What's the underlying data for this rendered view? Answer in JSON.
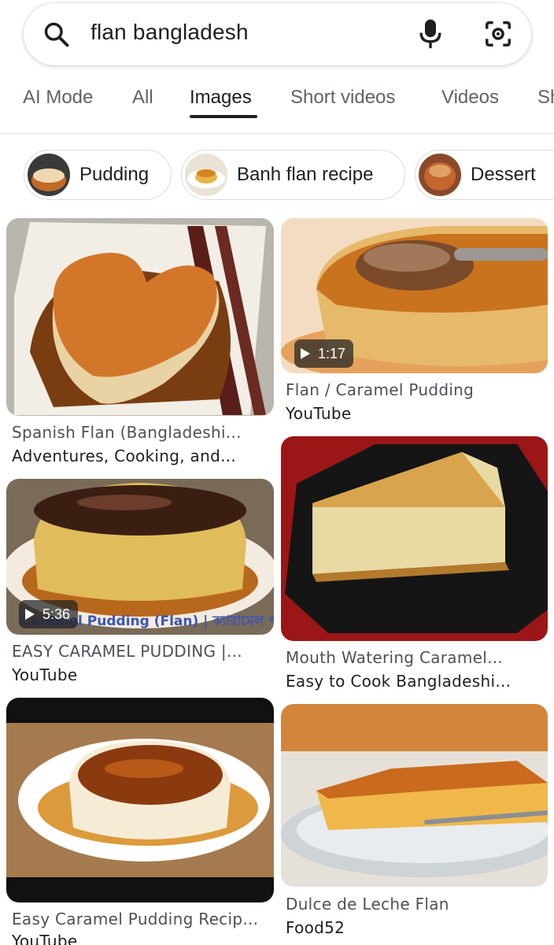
{
  "search": {
    "query": "flan bangladesh"
  },
  "tabs": [
    {
      "label": "AI Mode"
    },
    {
      "label": "All"
    },
    {
      "label": "Images",
      "active": true
    },
    {
      "label": "Short videos"
    },
    {
      "label": "Videos"
    },
    {
      "label": "Sh"
    }
  ],
  "chips": [
    {
      "label": "Pudding"
    },
    {
      "label": "Banh flan recipe"
    },
    {
      "label": "Dessert"
    }
  ],
  "results": [
    {
      "title": "Spanish Flan (Bangladeshi...",
      "source": "Adventures, Cooking, and..."
    },
    {
      "title": "Flan / Caramel Pudding",
      "source": "YouTube",
      "duration": "1:17"
    },
    {
      "title": "EASY CARAMEL PUDDING |...",
      "source": "YouTube",
      "duration": "5:36",
      "overlay": "Caramel Pudding (Flan) | ক্যারামেল পুডিং"
    },
    {
      "title": "Mouth Watering Caramel...",
      "source": "Easy to Cook Bangladeshi..."
    },
    {
      "title": "Easy Caramel Pudding Recip...",
      "source": "YouTube"
    },
    {
      "title": "Dulce de Leche Flan",
      "source": "Food52"
    }
  ],
  "colors": {
    "active_tab": "#1f1f1f",
    "inactive_tab": "#5f6368",
    "caption_title": "#4d5156",
    "chip_border": "#dadce0"
  }
}
